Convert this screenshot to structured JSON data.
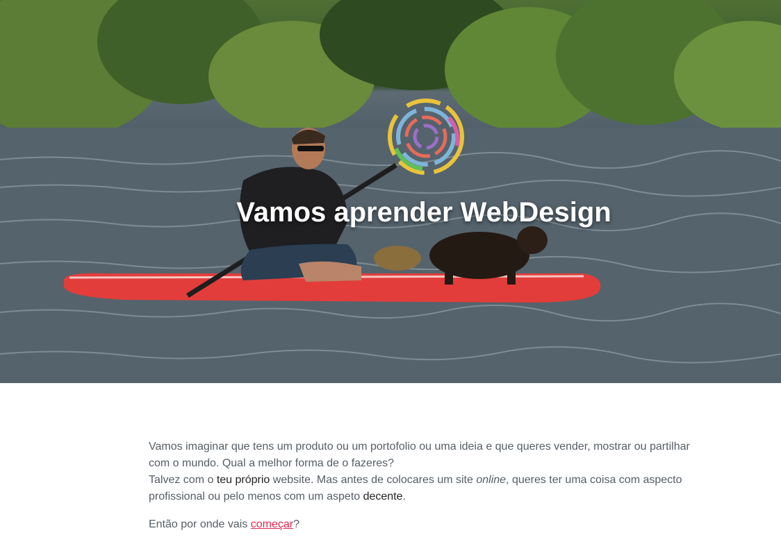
{
  "hero": {
    "title": "Vamos aprender WebDesign",
    "logo_icon": "circular-rainbow-logo-icon",
    "image_subject": "man-paddleboarding-with-dog"
  },
  "intro": {
    "p1_a": "Vamos imaginar que tens um produto ou um portofolio ou uma ideia e que queres vender, mostrar ou partilhar com o mundo. Qual a melhor forma de o fazeres?",
    "p1_b": "Talvez com o ",
    "p1_highlight_1": "teu próprio",
    "p1_c": " website. Mas antes de colocares um site ",
    "p1_em": "online",
    "p1_d": ", queres ter uma coisa com aspecto profissional ou pelo menos com um aspeto ",
    "p1_highlight_2": "decente",
    "p1_e": "."
  },
  "cta": {
    "before": "Então por onde vais ",
    "link": "começar",
    "after": "?"
  },
  "colors": {
    "link": "#e2284f",
    "body_text": "#555d66",
    "highlight_text": "#222222"
  }
}
